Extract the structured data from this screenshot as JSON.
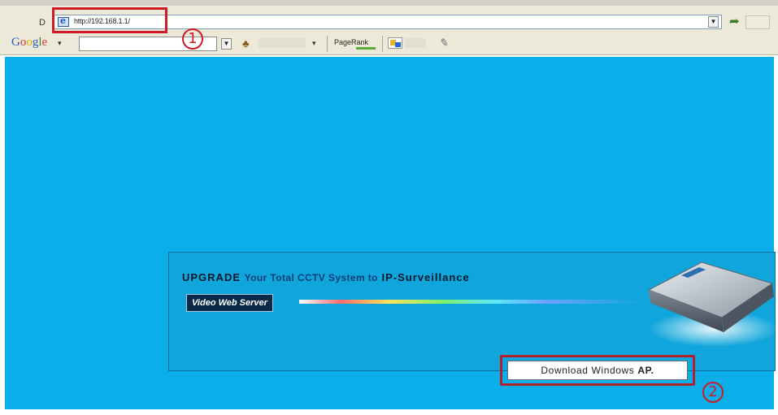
{
  "browser": {
    "address_label": "D",
    "url": "http://192.168.1.1/"
  },
  "toolbar": {
    "google_logo": [
      "G",
      "o",
      "o",
      "g",
      "l",
      "e"
    ],
    "google_caret": "▾",
    "tb_caret": "▾",
    "pagerank_label": "PageRank"
  },
  "page": {
    "headline_strong": "UPGRADE",
    "headline_mid": "Your Total CCTV System to",
    "headline_tail": "IP-Surveillance",
    "product_label": "Video Web Server",
    "download_text": "Download Windows",
    "download_bold": "AP."
  },
  "annotations": {
    "marker_1": "1",
    "marker_2": "2",
    "color": "#cf1b25"
  },
  "colors": {
    "page_bg": "#0aaee8",
    "banner_bg": "#11a6db"
  }
}
